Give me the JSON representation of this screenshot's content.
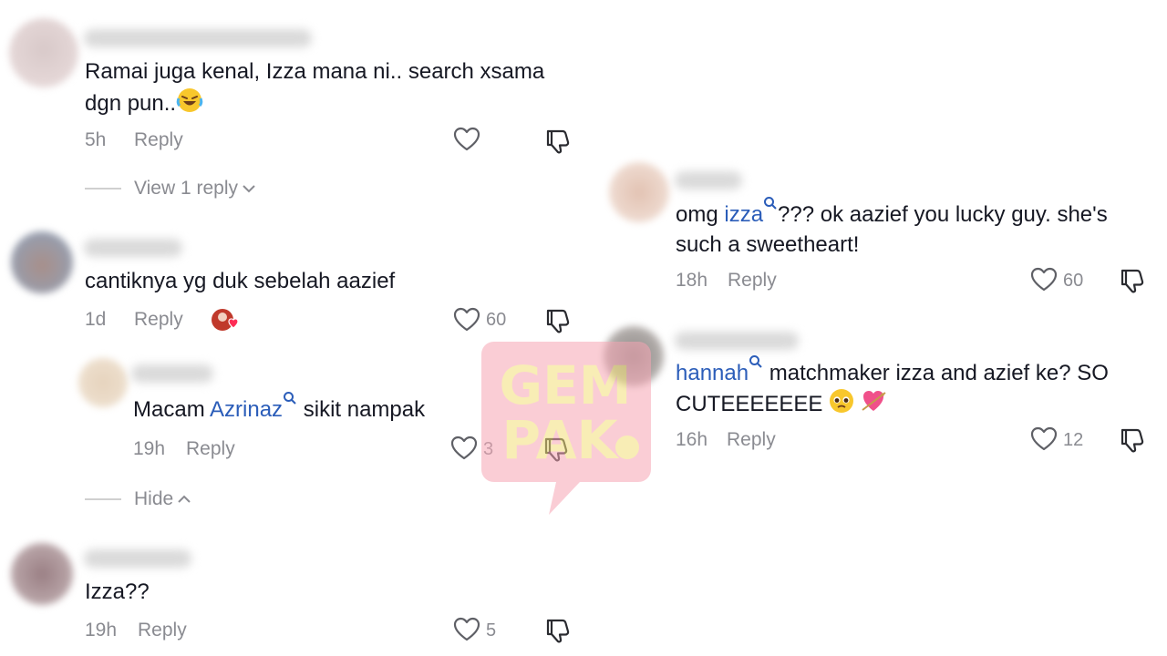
{
  "comments": [
    {
      "text": "Ramai juga kenal, Izza mana ni.. search xsama",
      "text2": "dgn pun..",
      "time": "5h",
      "reply": "Reply",
      "view_replies": "View 1 reply"
    },
    {
      "text": "cantiknya yg duk sebelah aazief",
      "time": "1d",
      "reply": "Reply",
      "likes": "60",
      "hide": "Hide"
    },
    {
      "prefix": "Macam ",
      "mention": "Azrinaz",
      "suffix": " sikit nampak",
      "time": "19h",
      "reply": "Reply",
      "likes": "3"
    },
    {
      "text": "Izza??",
      "time": "19h",
      "reply": "Reply",
      "likes": "5"
    },
    {
      "prefix": "omg ",
      "mention": "izza",
      "suffix": "??? ok aazief you lucky guy. she's",
      "text2": "such a sweetheart!",
      "time": "18h",
      "reply": "Reply",
      "likes": "60"
    },
    {
      "mention": "hannah",
      "suffix": " matchmaker izza and azief ke? SO",
      "text2": "CUTEEEEEEE",
      "time": "16h",
      "reply": "Reply",
      "likes": "12"
    }
  ],
  "watermark": {
    "line1": "GEM",
    "line2": "PAK",
    "color": "#f7a6b4",
    "text_color": "#f4e07a"
  },
  "colors": {
    "mention": "#2b5db9",
    "meta": "#8a8b91",
    "text": "#161823"
  },
  "icons": [
    "heart-icon",
    "dislike-icon",
    "magnifier-icon",
    "chevron-down-icon",
    "chevron-up-icon"
  ]
}
